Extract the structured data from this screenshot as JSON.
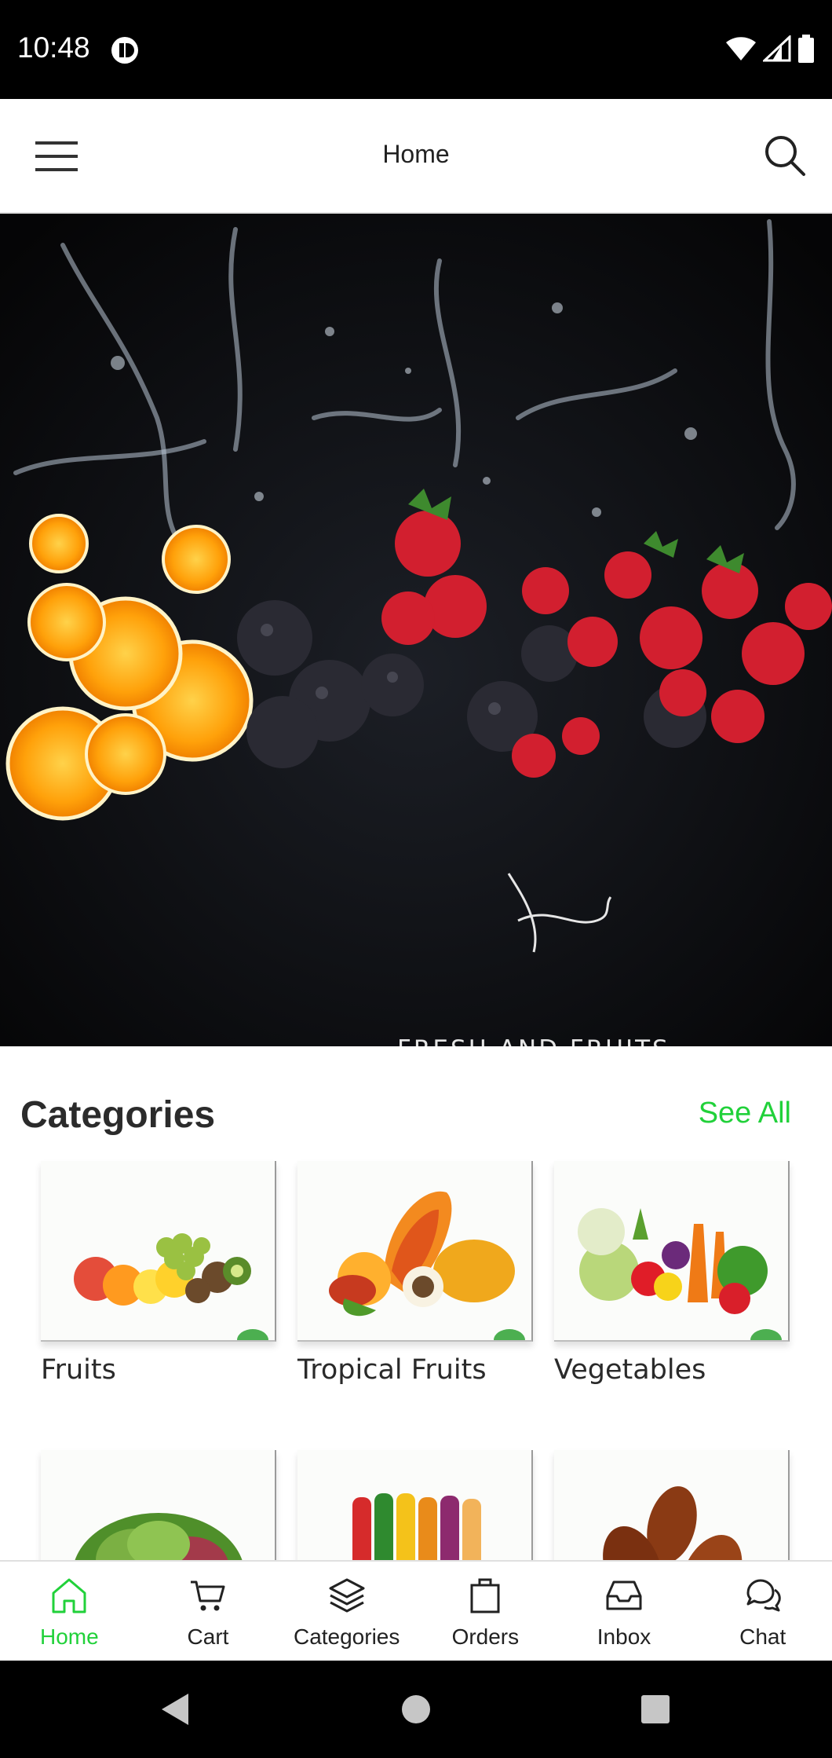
{
  "status_bar": {
    "time": "10:48"
  },
  "app_bar": {
    "title": "Home"
  },
  "banner": {
    "caption": "FRESH AND FRUITS",
    "dot_count": 3,
    "active_dot": 0
  },
  "categories": {
    "title": "Categories",
    "see_all_label": "See All",
    "items": [
      {
        "label": "Fruits"
      },
      {
        "label": "Tropical Fruits"
      },
      {
        "label": "Vegetables"
      },
      {
        "label": ""
      },
      {
        "label": ""
      },
      {
        "label": ""
      }
    ]
  },
  "bottom_nav": {
    "items": [
      {
        "label": "Home",
        "icon": "home-icon",
        "active": true
      },
      {
        "label": "Cart",
        "icon": "cart-icon",
        "active": false
      },
      {
        "label": "Categories",
        "icon": "layers-icon",
        "active": false
      },
      {
        "label": "Orders",
        "icon": "shopping-bag-icon",
        "active": false
      },
      {
        "label": "Inbox",
        "icon": "inbox-icon",
        "active": false
      },
      {
        "label": "Chat",
        "icon": "chat-icon",
        "active": false
      }
    ]
  },
  "colors": {
    "accent": "#21d13a",
    "status_bar": "#000000",
    "text": "#222222"
  }
}
